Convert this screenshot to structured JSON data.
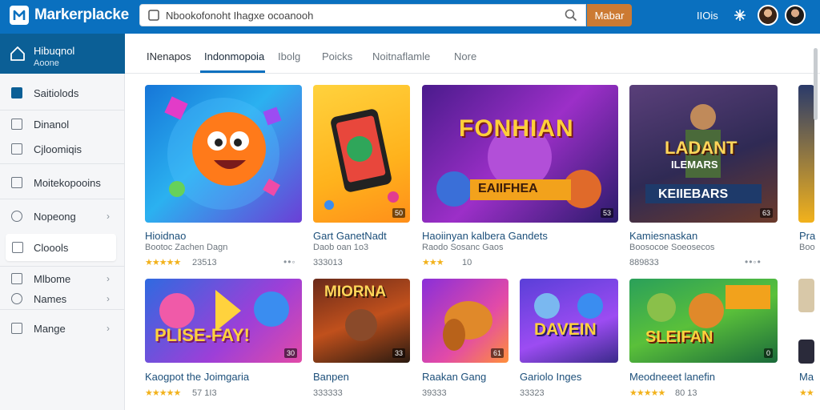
{
  "app": {
    "name": "Markerplacke"
  },
  "search": {
    "placeholder": "Nbookofonoht Ihagxe ocoanooh",
    "button_label": "Mabar"
  },
  "topbar": {
    "link": "IIOis"
  },
  "sidebar": {
    "home": {
      "label": "Hibuqnol",
      "sublabel": "Aoone"
    },
    "items": [
      {
        "label": "Saitiolods",
        "icon": "grid-icon"
      },
      {
        "label": "Dinanol",
        "icon": "doc-icon"
      },
      {
        "label": "Cjloomiqis",
        "icon": "box-icon"
      },
      {
        "label": "Moitekopooins",
        "icon": "list-icon"
      },
      {
        "label": "Nopeong",
        "icon": "circle-icon"
      },
      {
        "label": "Cloools",
        "icon": "square-icon"
      },
      {
        "label": "Mlbome",
        "icon": "box-icon"
      },
      {
        "label": "Names",
        "icon": "circle-icon"
      },
      {
        "label": "Mange",
        "icon": "square-icon"
      }
    ]
  },
  "tabs": [
    "INenapos",
    "Indonmopoia",
    "Ibolg",
    "Poicks",
    "Noitnaflamle",
    "Nore"
  ],
  "cards_row1": [
    {
      "title": "Hioidnao",
      "sub": "Bootoc Zachen Dagn",
      "rating": "23513",
      "stars": 5
    },
    {
      "title": "Gart GanetNadt",
      "sub": "Daob oan 1o3",
      "rating": "333013",
      "stars": 0
    },
    {
      "title": "Haoiinyan kalbera Gandets",
      "sub": "Raodo Sosanc Gaos",
      "rating": "10",
      "stars": 3
    },
    {
      "title": "Kamiesnaskan",
      "sub": "Boosocoe Soeosecos",
      "rating": "889833",
      "stars": 0
    },
    {
      "title": "Pra",
      "sub": "Boo",
      "rating": "",
      "stars": 0
    }
  ],
  "cards_row2": [
    {
      "title": "Kaogpot the Joimgaria",
      "rating": "57 1I3",
      "stars": 5
    },
    {
      "title": "Banpen",
      "rating": "333333",
      "stars": 0
    },
    {
      "title": "Raakan Gang",
      "rating": "39333",
      "stars": 0
    },
    {
      "title": "Gariolo Inges",
      "rating": "33323",
      "stars": 0
    },
    {
      "title": "Meodneeet lanefin",
      "rating": "80 13",
      "stars": 5
    },
    {
      "title": "Ma",
      "rating": "",
      "stars": 5
    }
  ],
  "image_labels": {
    "row1_3": "FONHIAN",
    "row1_3b": "EAIIFHEA",
    "row1_4": "LADANT",
    "row1_4b": "ILEMARS",
    "row1_4c": "KEIIEBARS",
    "row2_1": "PLISE-FAY!",
    "row2_2": "MIORNA",
    "row2_4": "DAVEIN",
    "row2_5": "SLEIFAN"
  },
  "badges": [
    "50",
    "53",
    "63",
    "30",
    "33",
    "61",
    "0"
  ],
  "colors": {
    "brand": "#0a70bf",
    "search_button": "#cc7a33",
    "sidebar_home": "#0b5f96",
    "star": "#f2b21c"
  }
}
